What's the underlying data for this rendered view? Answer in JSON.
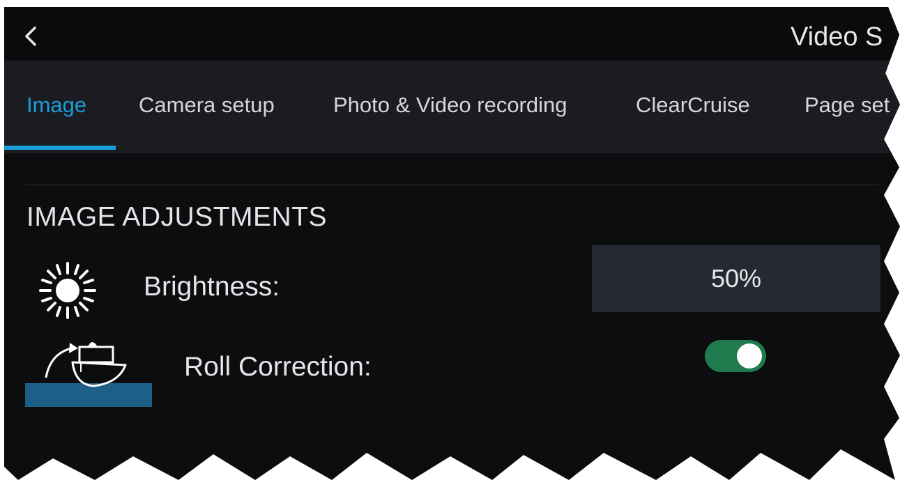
{
  "header": {
    "title": "Video S"
  },
  "tabs": [
    {
      "label": "Image",
      "active": true
    },
    {
      "label": "Camera setup",
      "active": false
    },
    {
      "label": "Photo & Video recording",
      "active": false
    },
    {
      "label": "ClearCruise",
      "active": false
    },
    {
      "label": "Page set",
      "active": false
    }
  ],
  "section": {
    "heading": "IMAGE ADJUSTMENTS"
  },
  "settings": {
    "brightness": {
      "label": "Brightness:",
      "value": "50%",
      "icon": "sun-icon"
    },
    "roll_correction": {
      "label": "Roll Correction:",
      "enabled": true,
      "icon": "boat-roll-icon"
    }
  },
  "colors": {
    "accent": "#1a9ed8",
    "toggle_on": "#1f7a4d",
    "background": "#0c0d0f",
    "tab_bar": "#1a1c22"
  }
}
